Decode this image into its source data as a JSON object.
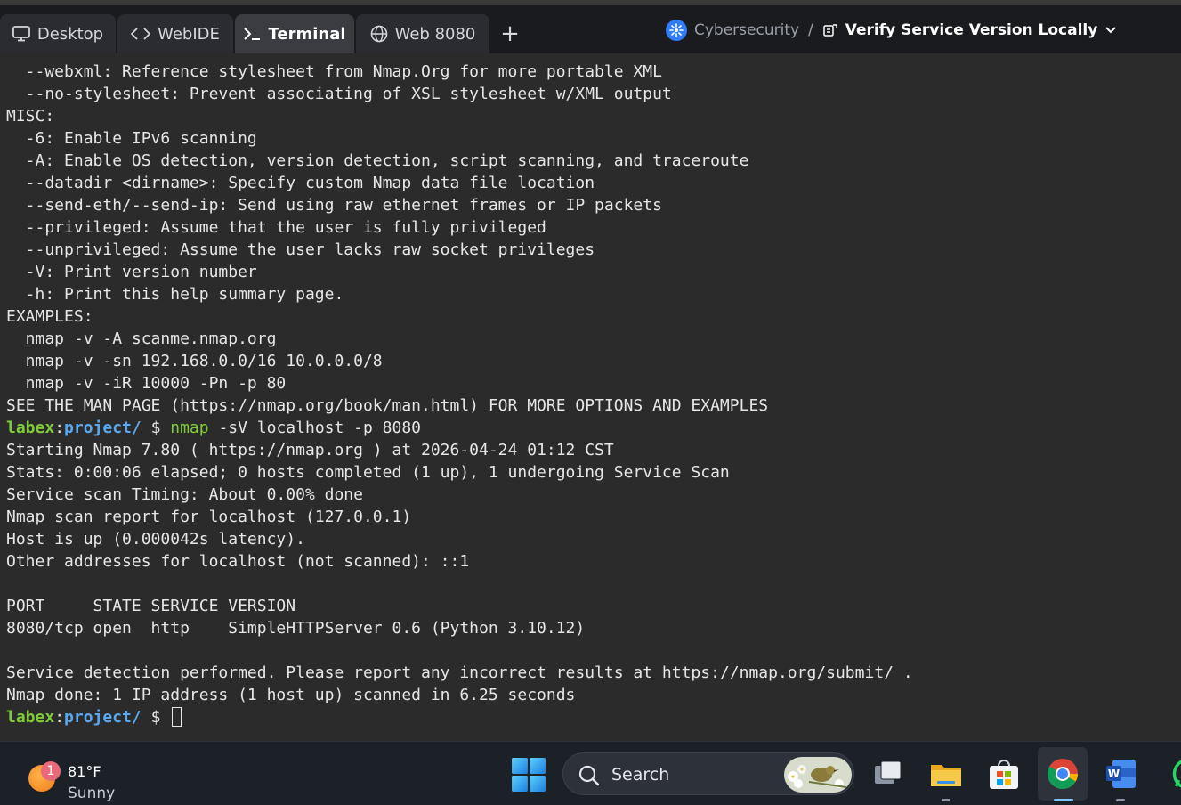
{
  "tabs": [
    {
      "label": "Desktop",
      "icon": "monitor-icon"
    },
    {
      "label": "WebIDE",
      "icon": "code-icon"
    },
    {
      "label": "Terminal",
      "icon": "terminal-icon",
      "active": true
    },
    {
      "label": "Web 8080",
      "icon": "globe-icon"
    }
  ],
  "new_tab": "+",
  "breadcrumb": {
    "category": "Cybersecurity",
    "separator": "/",
    "lab": "Verify Service Version Locally"
  },
  "terminal": {
    "lines": [
      "  --webxml: Reference stylesheet from Nmap.Org for more portable XML",
      "  --no-stylesheet: Prevent associating of XSL stylesheet w/XML output",
      "MISC:",
      "  -6: Enable IPv6 scanning",
      "  -A: Enable OS detection, version detection, script scanning, and traceroute",
      "  --datadir <dirname>: Specify custom Nmap data file location",
      "  --send-eth/--send-ip: Send using raw ethernet frames or IP packets",
      "  --privileged: Assume that the user is fully privileged",
      "  --unprivileged: Assume the user lacks raw socket privileges",
      "  -V: Print version number",
      "  -h: Print this help summary page.",
      "EXAMPLES:",
      "  nmap -v -A scanme.nmap.org",
      "  nmap -v -sn 192.168.0.0/16 10.0.0.0/8",
      "  nmap -v -iR 10000 -Pn -p 80",
      "SEE THE MAN PAGE (https://nmap.org/book/man.html) FOR MORE OPTIONS AND EXAMPLES"
    ],
    "prompt": {
      "user": "labex",
      "colon": ":",
      "path": "project/",
      "sign": " $ "
    },
    "command": {
      "name": "nmap",
      "args": " -sV localhost -p 8080"
    },
    "output": [
      "Starting Nmap 7.80 ( https://nmap.org ) at 2026-04-24 01:12 CST",
      "Stats: 0:00:06 elapsed; 0 hosts completed (1 up), 1 undergoing Service Scan",
      "Service scan Timing: About 0.00% done",
      "Nmap scan report for localhost (127.0.0.1)",
      "Host is up (0.000042s latency).",
      "Other addresses for localhost (not scanned): ::1",
      "",
      "PORT     STATE SERVICE VERSION",
      "8080/tcp open  http    SimpleHTTPServer 0.6 (Python 3.10.12)",
      "",
      "Service detection performed. Please report any incorrect results at https://nmap.org/submit/ .",
      "Nmap done: 1 IP address (1 host up) scanned in 6.25 seconds"
    ]
  },
  "taskbar": {
    "weather": {
      "temp": "81°F",
      "condition": "Sunny",
      "badge": "1"
    },
    "search": {
      "label": "Search"
    }
  },
  "colors": {
    "prompt_user": "#7fcb3a",
    "prompt_path": "#5aa9f0",
    "terminal_bg": "#2b2b2b",
    "tabbar_bg": "#1a1b1e"
  }
}
